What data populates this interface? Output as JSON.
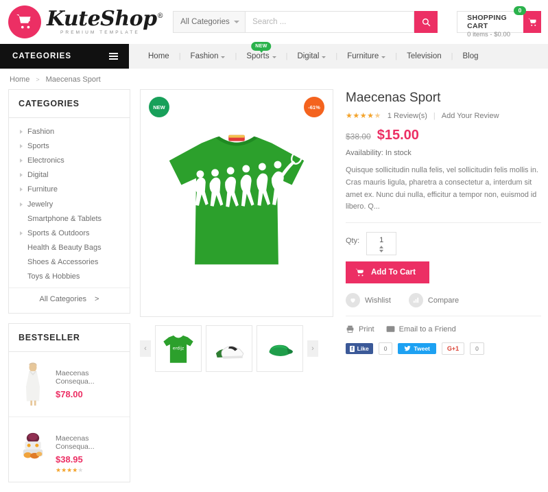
{
  "header": {
    "logo": {
      "name": "KuteShop",
      "registered": "®",
      "tagline": "PREMIUM TEMPLATE",
      "cart_icon": "shopping-cart-icon"
    },
    "search": {
      "category": "All Categories",
      "placeholder": "Search ...",
      "value": "",
      "button_icon": "search-icon"
    },
    "cart": {
      "title": "SHOPPING CART",
      "summary": "0 items - $0.00",
      "badge": "0",
      "icon": "cart-icon"
    },
    "accent_color": "#ec2f64",
    "badge_color": "#2bb24c"
  },
  "nav": {
    "categories_label": "CATEGORIES",
    "menu_icon": "hamburger-icon",
    "items": [
      {
        "label": "Home",
        "caret": false,
        "badge": ""
      },
      {
        "label": "Fashion",
        "caret": true,
        "badge": ""
      },
      {
        "label": "Sports",
        "caret": true,
        "badge": "NEW"
      },
      {
        "label": "Digital",
        "caret": true,
        "badge": ""
      },
      {
        "label": "Furniture",
        "caret": true,
        "badge": ""
      },
      {
        "label": "Television",
        "caret": false,
        "badge": ""
      },
      {
        "label": "Blog",
        "caret": false,
        "badge": ""
      }
    ]
  },
  "breadcrumb": {
    "home": "Home",
    "separator": ">",
    "current": "Maecenas Sport"
  },
  "sidebar": {
    "categories": {
      "title": "CATEGORIES",
      "items": [
        {
          "label": "Fashion",
          "arrow": true
        },
        {
          "label": "Sports",
          "arrow": true
        },
        {
          "label": "Electronics",
          "arrow": true
        },
        {
          "label": "Digital",
          "arrow": true
        },
        {
          "label": "Furniture",
          "arrow": true
        },
        {
          "label": "Jewelry",
          "arrow": true
        },
        {
          "label": "Smartphone & Tablets",
          "arrow": false
        },
        {
          "label": "Sports & Outdoors",
          "arrow": true
        },
        {
          "label": "Health & Beauty Bags",
          "arrow": false
        },
        {
          "label": "Shoes & Accessories",
          "arrow": false
        },
        {
          "label": "Toys & Hobbies",
          "arrow": false
        }
      ],
      "all_label": "All Categories",
      "all_arrow": ">"
    },
    "bestseller": {
      "title": "BESTSELLER",
      "items": [
        {
          "name": "Maecenas Consequa...",
          "price": "$78.00",
          "stars_on": 0,
          "stars_off": 0,
          "thumb": "white-dress-thumb"
        },
        {
          "name": "Maecenas Consequa...",
          "price": "$38.95",
          "stars_on": 4,
          "stars_off": 1,
          "thumb": "cooker-thumb"
        }
      ]
    }
  },
  "product": {
    "title": "Maecenas Sport",
    "reviews": "1 Review(s)",
    "add_review": "Add Your Review",
    "review_separator": "|",
    "stars_on": 4,
    "stars_half": 1,
    "old_price": "$38.00",
    "price": "$15.00",
    "availability_label": "Availability:",
    "availability_value": "In stock",
    "description": "Quisque sollicitudin nulla felis, vel sollicitudin felis mollis in. Cras mauris ligula, pharetra a consectetur a, interdum sit amet ex. Nunc dui nulla, efficitur a tempor non, euismod id libero. Q...",
    "badge_new": "NEW",
    "badge_sale": "-61%",
    "main_image": "green-tshirt-evolution-tennis",
    "qty_label": "Qty:",
    "qty_value": "1",
    "add_to_cart": "Add To Cart",
    "add_to_cart_icon": "cart-icon",
    "actions": [
      {
        "label": "Wishlist",
        "icon": "heart-icon"
      },
      {
        "label": "Compare",
        "icon": "bar-chart-icon"
      }
    ],
    "share_links": [
      {
        "label": "Print",
        "icon": "printer-icon"
      },
      {
        "label": "Email to a Friend",
        "icon": "envelope-icon"
      }
    ],
    "social": {
      "facebook_label": "Like",
      "facebook_mark": "f",
      "facebook_count": "0",
      "twitter_label": "Tweet",
      "twitter_icon": "twitter-bird-icon",
      "google_label": "G+1",
      "google_count": "0"
    },
    "thumbnails": [
      {
        "name": "green-tshirt-thumb"
      },
      {
        "name": "white-shoes-thumb"
      },
      {
        "name": "green-visor-thumb"
      }
    ],
    "prev_arrow": "‹",
    "next_arrow": "›"
  }
}
